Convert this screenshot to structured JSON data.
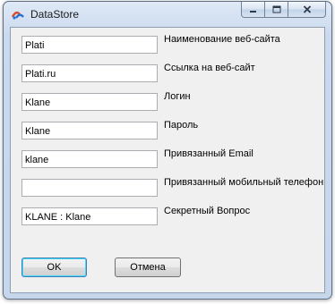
{
  "window": {
    "title": "DataStore",
    "icon": "datastore-app-icon",
    "controls": {
      "minimize": "minimize-icon",
      "maximize": "maximize-icon",
      "close": "close-icon"
    }
  },
  "form": {
    "fields": [
      {
        "value": "Plati",
        "label": "Наименование веб-сайта"
      },
      {
        "value": "Plati.ru",
        "label": "Ссылка на веб-сайт"
      },
      {
        "value": "Klane",
        "label": "Логин"
      },
      {
        "value": "Klane",
        "label": "Пароль"
      },
      {
        "value": "klane",
        "label": "Привязанный Email"
      },
      {
        "value": "",
        "label": "Привязанный мобильный телефон"
      },
      {
        "value": "KLANE : Klane",
        "label": "Секретный Вопрос"
      }
    ]
  },
  "buttons": {
    "ok": "OK",
    "cancel": "Отмена"
  }
}
